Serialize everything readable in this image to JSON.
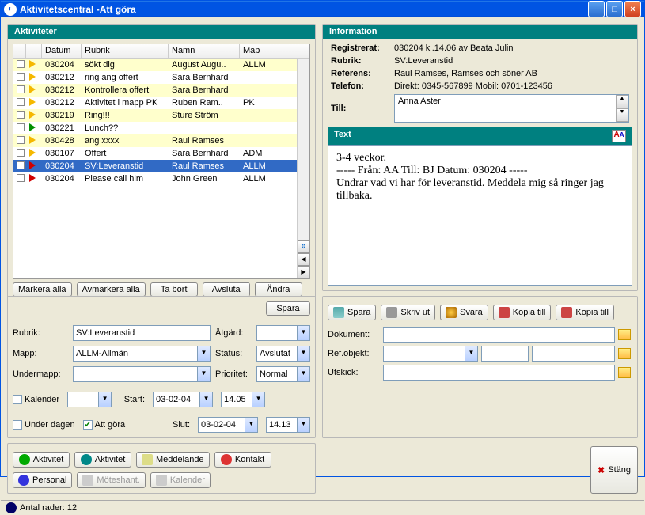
{
  "window": {
    "title": "Aktivitetscentral -Att göra"
  },
  "left": {
    "header": "Aktiviteter",
    "columns": {
      "c0": "",
      "c1": "",
      "c2": "Datum",
      "c3": "Rubrik",
      "c4": "Namn",
      "c5": "Map"
    },
    "rows": [
      {
        "flag": "yellow",
        "date": "030204",
        "rubrik": "sökt dig",
        "namn": "August Augu..",
        "map": "ALLM",
        "bg": "yellow"
      },
      {
        "flag": "yellow",
        "date": "030212",
        "rubrik": "ring ang offert",
        "namn": "Sara Bernhard",
        "map": "",
        "bg": ""
      },
      {
        "flag": "yellow",
        "date": "030212",
        "rubrik": "Kontrollera offert",
        "namn": "Sara Bernhard",
        "map": "",
        "bg": "yellow"
      },
      {
        "flag": "yellow",
        "date": "030212",
        "rubrik": "Aktivitet i mapp PK",
        "namn": "Ruben Ram..",
        "map": "PK",
        "bg": ""
      },
      {
        "flag": "yellow",
        "date": "030219",
        "rubrik": "Ring!!!",
        "namn": "Sture Ström",
        "map": "",
        "bg": "yellow"
      },
      {
        "flag": "green",
        "date": "030221",
        "rubrik": "Lunch??",
        "namn": "",
        "map": "",
        "bg": ""
      },
      {
        "flag": "yellow",
        "date": "030428",
        "rubrik": "ang xxxx",
        "namn": "Raul Ramses",
        "map": "",
        "bg": "yellow"
      },
      {
        "flag": "yellow",
        "date": "030107",
        "rubrik": "Offert",
        "namn": "Sara Bernhard",
        "map": "ADM",
        "bg": ""
      },
      {
        "flag": "red",
        "date": "030204",
        "rubrik": "SV:Leveranstid",
        "namn": "Raul Ramses",
        "map": "ALLM",
        "bg": "selected"
      },
      {
        "flag": "red",
        "date": "030204",
        "rubrik": "Please call him",
        "namn": "John Green",
        "map": "ALLM",
        "bg": ""
      }
    ],
    "buttons": {
      "markAll": "Markera alla",
      "unmarkAll": "Avmarkera alla",
      "delete": "Ta bort",
      "finish": "Avsluta",
      "edit": "Ändra"
    }
  },
  "info": {
    "header": "Information",
    "labels": {
      "reg": "Registrerat:",
      "rubrik": "Rubrik:",
      "ref": "Referens:",
      "tel": "Telefon:",
      "till": "Till:"
    },
    "reg": "030204 kl.14.06 av Beata Julin",
    "rubrik": "SV:Leveranstid",
    "ref": "Raul Ramses, Ramses och söner AB",
    "tel": "Direkt: 0345-567899  Mobil: 0701-123456",
    "till": "Anna Aster"
  },
  "text": {
    "header": "Text",
    "body": "3-4 veckor.\n----- Från: AA Till: BJ Datum: 030204 -----\nUndrar vad vi har för leveranstid. Meddela mig så ringer jag tillbaka."
  },
  "form": {
    "save": "Spara",
    "labels": {
      "rubrik": "Rubrik:",
      "mapp": "Mapp:",
      "undermapp": "Undermapp:",
      "atgard": "Åtgärd:",
      "status": "Status:",
      "prio": "Prioritet:",
      "start": "Start:",
      "slut": "Slut:",
      "kalender": "Kalender",
      "underdagen": "Under dagen",
      "attgora": "Att göra"
    },
    "rubrik": "SV:Leveranstid",
    "mapp": "ALLM-Allmän",
    "undermapp": "",
    "atgard": "",
    "status": "Avslutat",
    "prio": "Normal",
    "startDate": "03-02-04",
    "startTime": "14.05",
    "slutDate": "03-02-04",
    "slutTime": "14.13",
    "kalenderChecked": false,
    "underdagenChecked": false,
    "attgoraChecked": true
  },
  "infoButtons": {
    "spara": "Spara",
    "skrivut": "Skriv ut",
    "svara": "Svara",
    "kopia1": "Kopia till",
    "kopia2": "Kopia till"
  },
  "docs": {
    "dokument": "Dokument:",
    "refobj": "Ref.objekt:",
    "utskick": "Utskick:"
  },
  "bottomBtns": {
    "aktivitet": "Aktivitet",
    "aktivitetPlus": "Aktivitet",
    "meddelande": "Meddelande",
    "kontakt": "Kontakt",
    "personal": "Personal",
    "moteshant": "Möteshant.",
    "kalender": "Kalender",
    "stang": "Stäng"
  },
  "status": {
    "label": "Antal rader: 12"
  }
}
